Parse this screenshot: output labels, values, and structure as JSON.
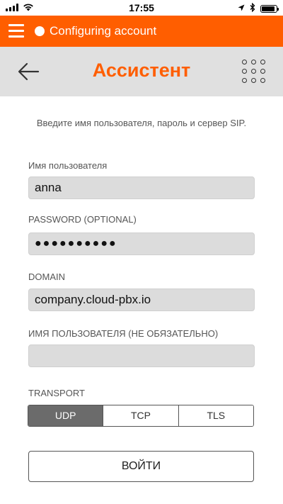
{
  "status_bar": {
    "time": "17:55"
  },
  "app_bar": {
    "title": "Configuring account",
    "status_color": "#ffffff",
    "accent_color": "#ff5e00"
  },
  "header": {
    "title": "Ассистент"
  },
  "form": {
    "instructions": "Введите имя пользователя, пароль и сервер SIP.",
    "username_label": "Имя пользователя",
    "username_value": "anna",
    "password_label": "PASSWORD (OPTIONAL)",
    "password_value": "●●●●●●●●●●",
    "domain_label": "DOMAIN",
    "domain_value": "company.cloud-pbx.io",
    "auth_username_label": "ИМЯ ПОЛЬЗОВАТЕЛЯ (НЕ ОБЯЗАТЕЛЬНО)",
    "auth_username_value": "",
    "transport_label": "TRANSPORT",
    "transport_options": [
      "UDP",
      "TCP",
      "TLS"
    ],
    "transport_selected": "UDP",
    "login_label": "ВОЙТИ"
  }
}
